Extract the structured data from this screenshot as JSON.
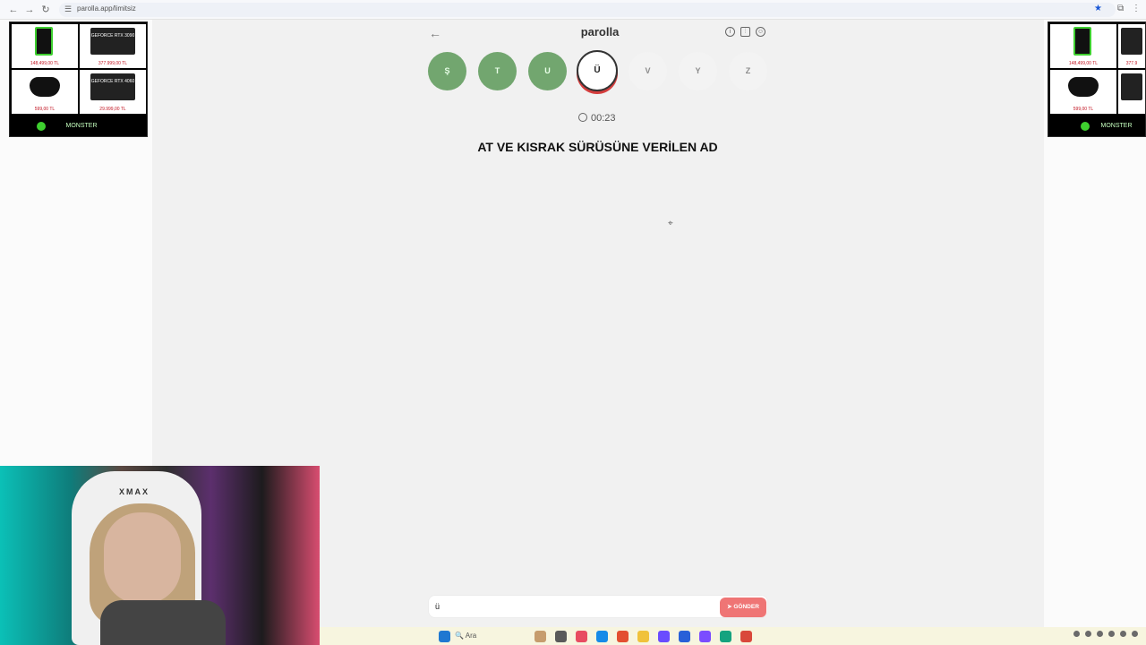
{
  "browser": {
    "url": "parolla.app/limitsiz",
    "nav_back": "←",
    "nav_forward": "→",
    "reload": "↻",
    "lock_icon": "☰",
    "star": "★",
    "extensions": "⧉",
    "menu": "⋮"
  },
  "ads": {
    "left": [
      {
        "type": "pc",
        "price": "148,499,00 TL"
      },
      {
        "type": "gpu",
        "label": "GEFORCE RTX 3090",
        "price": "377.999,00 TL"
      },
      {
        "type": "pad",
        "price": "599,00 TL"
      },
      {
        "type": "gpu",
        "label": "GEFORCE RTX 4060",
        "price": "29.999,00 TL"
      }
    ],
    "right": [
      {
        "type": "pc",
        "price": "148,499,00 TL"
      },
      {
        "type": "gpu",
        "label": "",
        "price": "377.9"
      },
      {
        "type": "pad",
        "price": "599,00 TL"
      },
      {
        "type": "gpu",
        "label": "",
        "price": ""
      }
    ],
    "brand": "MONSTER"
  },
  "game": {
    "title": "parolla",
    "back": "←",
    "icons": [
      "info-icon",
      "chart-icon",
      "profile-icon"
    ],
    "icon_glyphs": [
      "i",
      "⫶",
      "☺"
    ],
    "letters": [
      {
        "text": "Ş",
        "state": "done"
      },
      {
        "text": "T",
        "state": "done"
      },
      {
        "text": "U",
        "state": "done"
      },
      {
        "text": "Ü",
        "state": "active"
      },
      {
        "text": "V",
        "state": "pending"
      },
      {
        "text": "Y",
        "state": "pending"
      },
      {
        "text": "Z",
        "state": "pending"
      }
    ],
    "timer": "00:23",
    "question": "AT VE KISRAK SÜRÜSÜNE VERİLEN AD",
    "answer_value": "ü",
    "send_label": "GÖNDER",
    "send_icon": "➤"
  },
  "webcam": {
    "chair_text": "XMAX"
  },
  "taskbar": {
    "search_label": "Ara"
  }
}
